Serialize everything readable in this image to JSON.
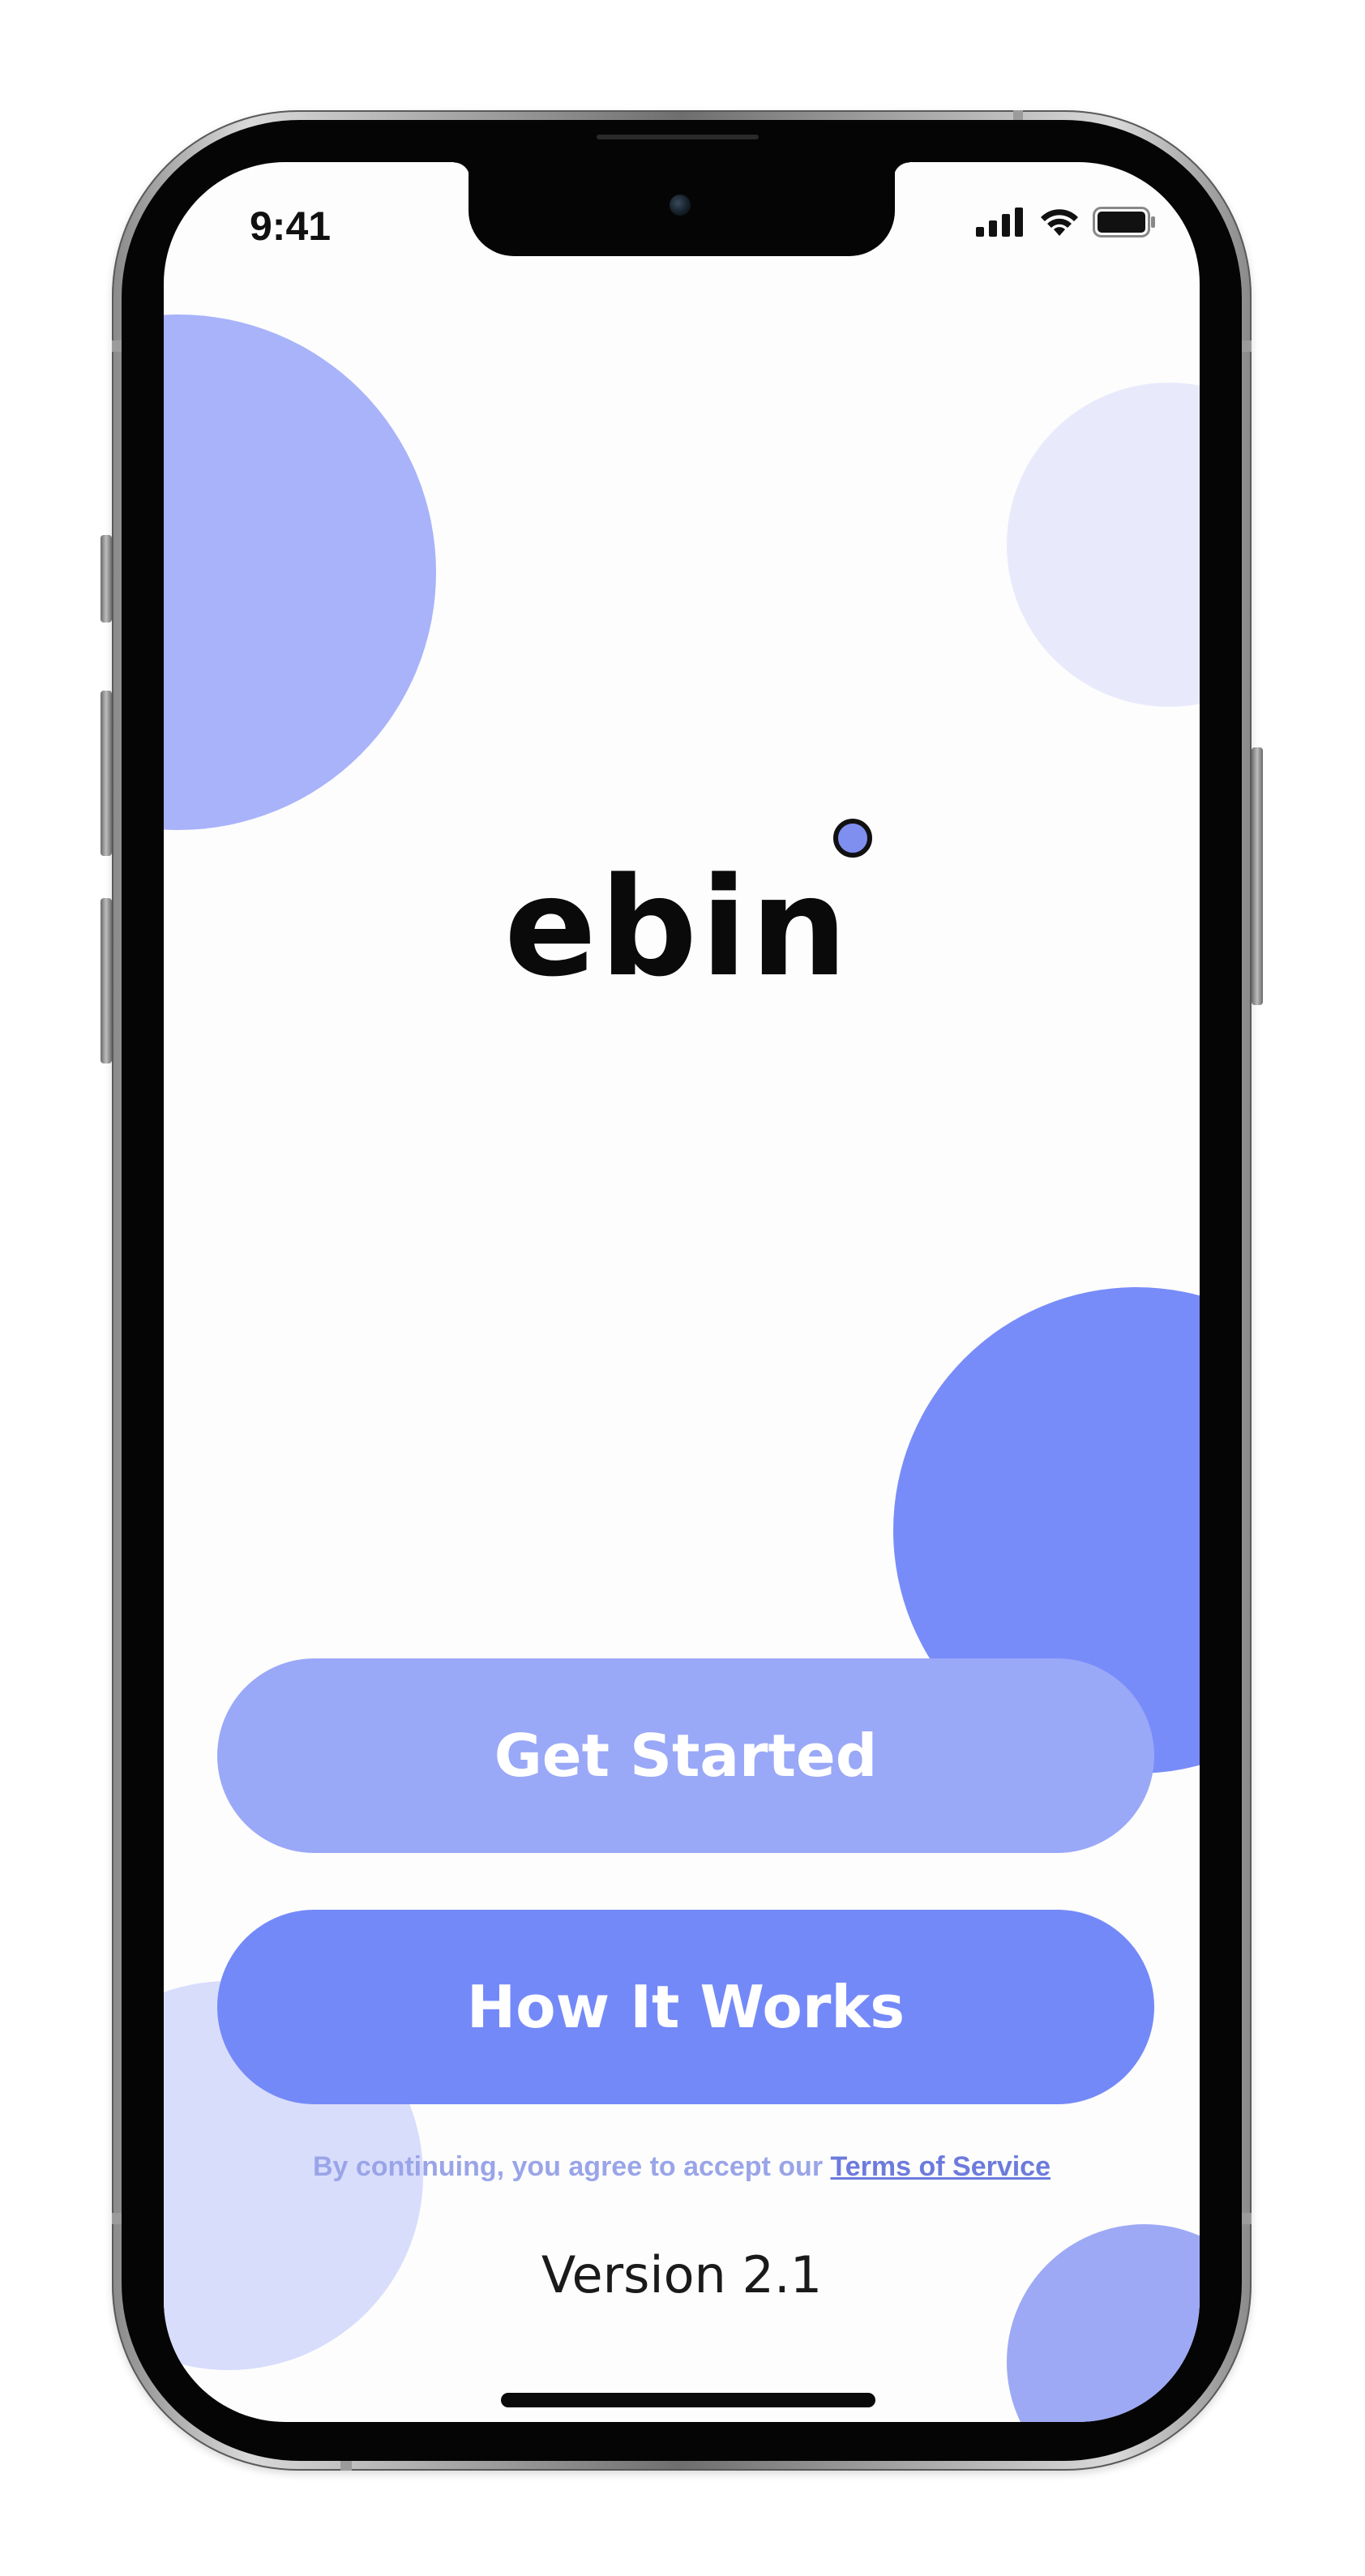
{
  "status_bar": {
    "time": "9:41",
    "icons": [
      "cellular-signal-icon",
      "wifi-icon",
      "battery-icon"
    ]
  },
  "logo": {
    "text": "ebin",
    "dot_color": "#7f8ff0"
  },
  "buttons": {
    "get_started": "Get Started",
    "how_it_works": "How It Works"
  },
  "terms": {
    "prefix": "By continuing, you agree to accept our ",
    "link": "Terms of Service"
  },
  "version": "Version 2.1",
  "colors": {
    "get_started_bg": "#9aa8f8",
    "how_it_works_bg": "#7489f8",
    "circle_top_left": "#a8b3fa",
    "circle_top_right": "#e8eafc",
    "circle_mid_right": "#788cf9",
    "circle_bottom_left": "#d9ddfc",
    "circle_bottom_right": "#9ea9f5",
    "terms_text": "#9aa5e8",
    "terms_link": "#6c7bdc"
  }
}
